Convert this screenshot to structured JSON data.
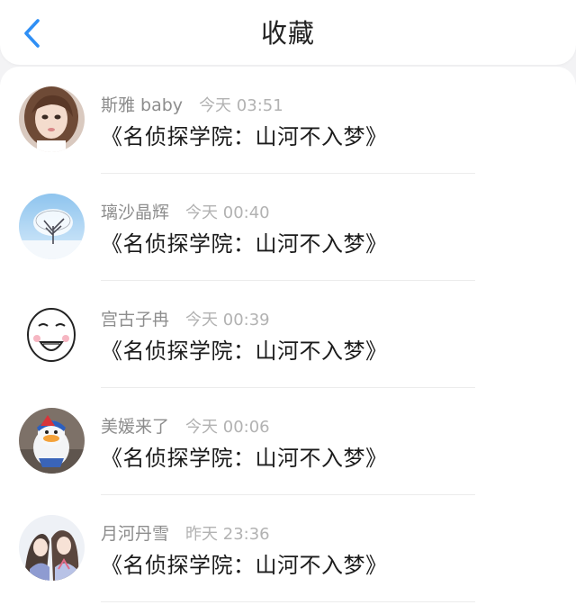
{
  "header": {
    "title": "收藏",
    "back_icon": "chevron-left-icon",
    "accent_color": "#2f8ff5"
  },
  "items": [
    {
      "name": "斯雅 baby",
      "time": "今天 03:51",
      "message": "《名侦探学院：山河不入梦》",
      "avatar": "photo-girl"
    },
    {
      "name": "璃沙晶辉",
      "time": "今天 00:40",
      "message": "《名侦探学院：山河不入梦》",
      "avatar": "snow-tree"
    },
    {
      "name": "宫古子冉",
      "time": "今天 00:39",
      "message": "《名侦探学院：山河不入梦》",
      "avatar": "meme-face"
    },
    {
      "name": "美媛来了",
      "time": "今天 00:06",
      "message": "《名侦探学院：山河不入梦》",
      "avatar": "duck"
    },
    {
      "name": "月河丹雪",
      "time": "昨天 23:36",
      "message": "《名侦探学院：山河不入梦》",
      "avatar": "anime-pair"
    }
  ]
}
